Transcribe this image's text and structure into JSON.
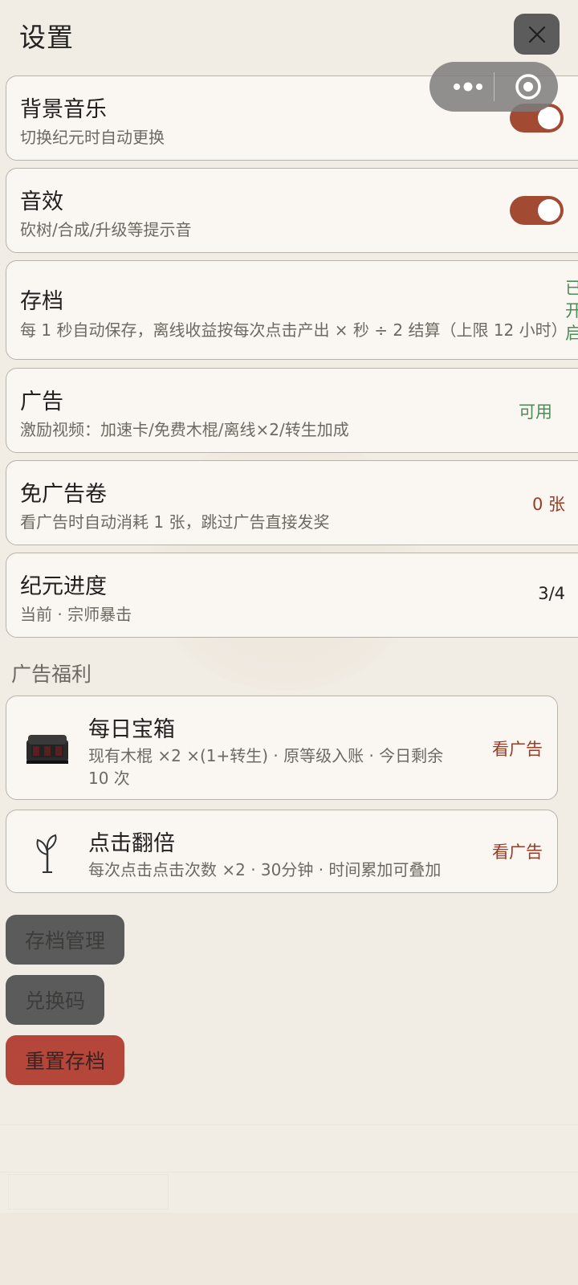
{
  "header": {
    "title": "设置"
  },
  "settings": [
    {
      "title": "背景音乐",
      "desc": "切换纪元时自动更换",
      "type": "toggle",
      "on": true
    },
    {
      "title": "音效",
      "desc": "砍树/合成/升级等提示音",
      "type": "toggle",
      "on": true
    },
    {
      "title": "存档",
      "desc": "每 1 秒自动保存，离线收益按每次点击产出 × 秒 ÷ 2 结算（上限 12 小时）",
      "type": "status",
      "status": "已开启"
    },
    {
      "title": "广告",
      "desc": "激励视频：加速卡/免费木棍/离线×2/转生加成",
      "type": "value",
      "value": "可用"
    },
    {
      "title": "免广告卷",
      "desc": "看广告时自动消耗 1 张，跳过广告直接发奖",
      "type": "value",
      "value": "0 张"
    },
    {
      "title": "纪元进度",
      "desc": "当前 · 宗师暴击",
      "type": "value",
      "value": "3/4"
    }
  ],
  "ad_section": {
    "label": "广告福利",
    "items": [
      {
        "title": "每日宝箱",
        "desc": "现有木棍 ×2 ×(1+转生) · 原等级入账 · 今日剩余 10 次",
        "action": "看广告",
        "icon": "treasure-chest-icon"
      },
      {
        "title": "点击翻倍",
        "desc": "每次点击点击次数 ×2 · 30分钟 · 时间累加可叠加",
        "action": "看广告",
        "icon": "sprout-icon"
      }
    ]
  },
  "buttons": {
    "save_manage": "存档管理",
    "redeem_code": "兑换码",
    "reset_save": "重置存档"
  },
  "colors": {
    "background": "#f1ece4",
    "card": "#faf7f2",
    "toggle_on": "#a34a33",
    "status_green": "#4f8a5a",
    "accent_red": "#9a3c25",
    "danger_button": "#b4473a",
    "dark_button": "#5b5b5b"
  }
}
